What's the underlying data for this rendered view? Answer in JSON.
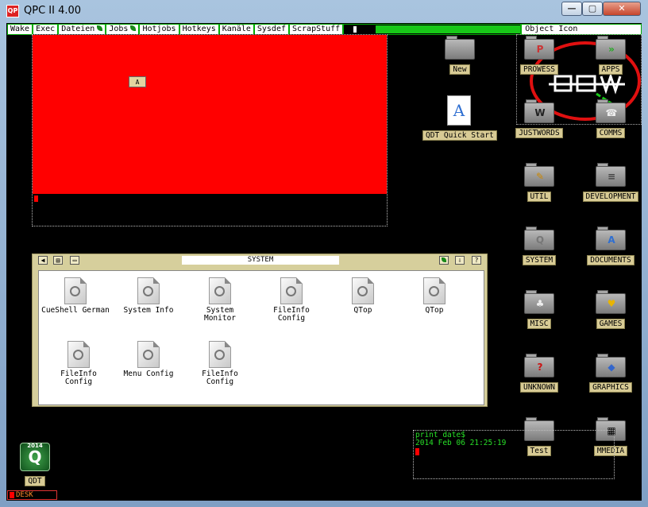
{
  "window": {
    "title": "QPC II 4.00",
    "app_icon": "QP",
    "minimize": "—",
    "maximize": "▢",
    "close": "✕"
  },
  "menubar": {
    "items": [
      "Wake",
      "Exec",
      "Dateien",
      "Jobs",
      "Hotjobs",
      "Hotkeys",
      "Kanäle",
      "Sysdef",
      "ScrapStuff"
    ],
    "object_label": "Object Icon",
    "progress": 0.18
  },
  "red_window": {
    "icon_text": "A"
  },
  "system_window": {
    "title": "SYSTEM",
    "files": [
      "CueShell German",
      "System Info",
      "System\nMonitor",
      "FileInfo\nConfig",
      "QTop",
      "QTop",
      "FileInfo\nConfig",
      "Menu Config",
      "FileInfo\nConfig"
    ]
  },
  "desktop": {
    "new": "New",
    "qdt_quick_start": "QDT Quick Start",
    "folders": [
      {
        "label": "PROWESS",
        "icon": "prowess-icon",
        "glyph": "P"
      },
      {
        "label": "APPS",
        "icon": "apps-icon",
        "glyph": "»"
      },
      {
        "label": "JUSTWORDS",
        "icon": "justwords-icon",
        "glyph": "W"
      },
      {
        "label": "COMMS",
        "icon": "comms-icon",
        "glyph": "☎"
      },
      {
        "label": "UTIL",
        "icon": "util-icon",
        "glyph": "✎"
      },
      {
        "label": "DEVELOPMENT",
        "icon": "development-icon",
        "glyph": "≡"
      },
      {
        "label": "SYSTEM",
        "icon": "system-icon",
        "glyph": "Q"
      },
      {
        "label": "DOCUMENTS",
        "icon": "documents-icon",
        "glyph": "A"
      },
      {
        "label": "MISC",
        "icon": "misc-icon",
        "glyph": "♣"
      },
      {
        "label": "GAMES",
        "icon": "games-icon",
        "glyph": "♥"
      },
      {
        "label": "UNKNOWN",
        "icon": "unknown-icon",
        "glyph": "?"
      },
      {
        "label": "GRAPHICS",
        "icon": "graphics-icon",
        "glyph": "◆"
      },
      {
        "label": "Test",
        "icon": "folder-icon",
        "glyph": ""
      },
      {
        "label": "MMEDIA",
        "icon": "mmedia-icon",
        "glyph": "▦"
      }
    ],
    "qdt_label": "QDT",
    "qdt_year": "2014",
    "desk_label": "DESK"
  },
  "console": {
    "line1": "print date$",
    "line2": "2014 Feb 06 21:25:19"
  },
  "colors": {
    "red_area": "#ff0000",
    "console_text": "#28e028",
    "menu_border": "#00aa00"
  }
}
